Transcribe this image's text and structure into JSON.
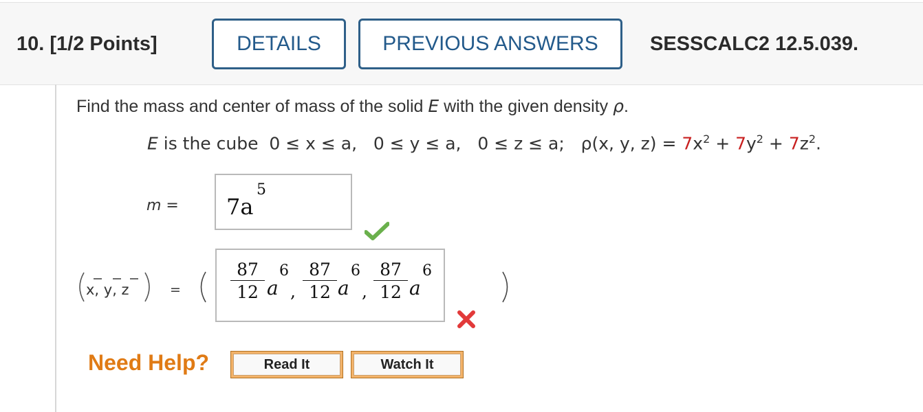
{
  "header": {
    "question_number": "10.",
    "points": "[1/2 Points]",
    "details_label": "DETAILS",
    "previous_answers_label": "PREVIOUS ANSWERS",
    "problem_code": "SESSCALC2 12.5.039."
  },
  "problem": {
    "prompt_before": "Find the mass and center of mass of the solid ",
    "prompt_E": "E",
    "prompt_middle": " with the given density ",
    "prompt_rho": "ρ",
    "prompt_end": ".",
    "cube_E": "E",
    "cube_text": " is the cube  0 ≤ x ≤ a,   0 ≤ y ≤ a,   0 ≤ z ≤ a;   ρ(x, y, z) = ",
    "coef1": "7",
    "term1": "x",
    "plus1": " + ",
    "coef2": "7",
    "term2": "y",
    "plus2": " + ",
    "coef3": "7",
    "term3": "z",
    "exp": "2",
    "end": "."
  },
  "mass": {
    "label": "m =",
    "answer_base": "7a",
    "answer_exp": "5",
    "status": "correct"
  },
  "center_of_mass": {
    "label_vars": "x, y, z",
    "equals": "=",
    "fractions": [
      {
        "num": "87",
        "den": "12",
        "var": "a",
        "exp": "6"
      },
      {
        "num": "87",
        "den": "12",
        "var": "a",
        "exp": "6"
      },
      {
        "num": "87",
        "den": "12",
        "var": "a",
        "exp": "6"
      }
    ],
    "comma": ",",
    "status": "incorrect"
  },
  "help": {
    "label": "Need Help?",
    "read_it": "Read It",
    "watch_it": "Watch It"
  },
  "colors": {
    "header_bg": "#f7f7f7",
    "button_border": "#2e5f88",
    "button_text": "#235a8b",
    "coef_red": "#c81f1f",
    "check_green": "#6ab04c",
    "x_red": "#e23a3a",
    "need_help_orange": "#e07b15",
    "help_button_border": "#f3b36a"
  },
  "icons": {
    "check": "check-icon",
    "incorrect": "x-mark-icon"
  }
}
